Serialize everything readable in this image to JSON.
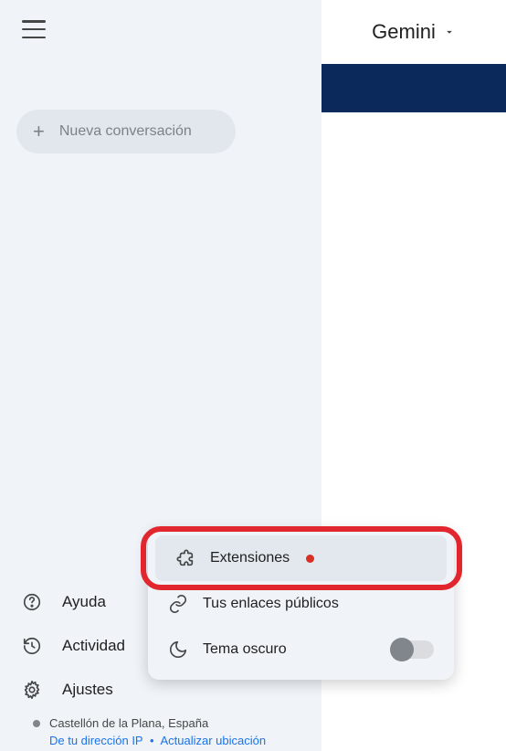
{
  "header": {
    "app_name": "Gemini"
  },
  "sidebar": {
    "new_chat_label": "Nueva conversación",
    "help_label": "Ayuda",
    "activity_label": "Actividad",
    "settings_label": "Ajustes"
  },
  "location": {
    "city": "Castellón de la Plana, España",
    "ip_text": "De tu dirección IP",
    "update_text": "Actualizar ubicación"
  },
  "popup": {
    "extensions_label": "Extensiones",
    "public_links_label": "Tus enlaces públicos",
    "dark_theme_label": "Tema oscuro"
  }
}
